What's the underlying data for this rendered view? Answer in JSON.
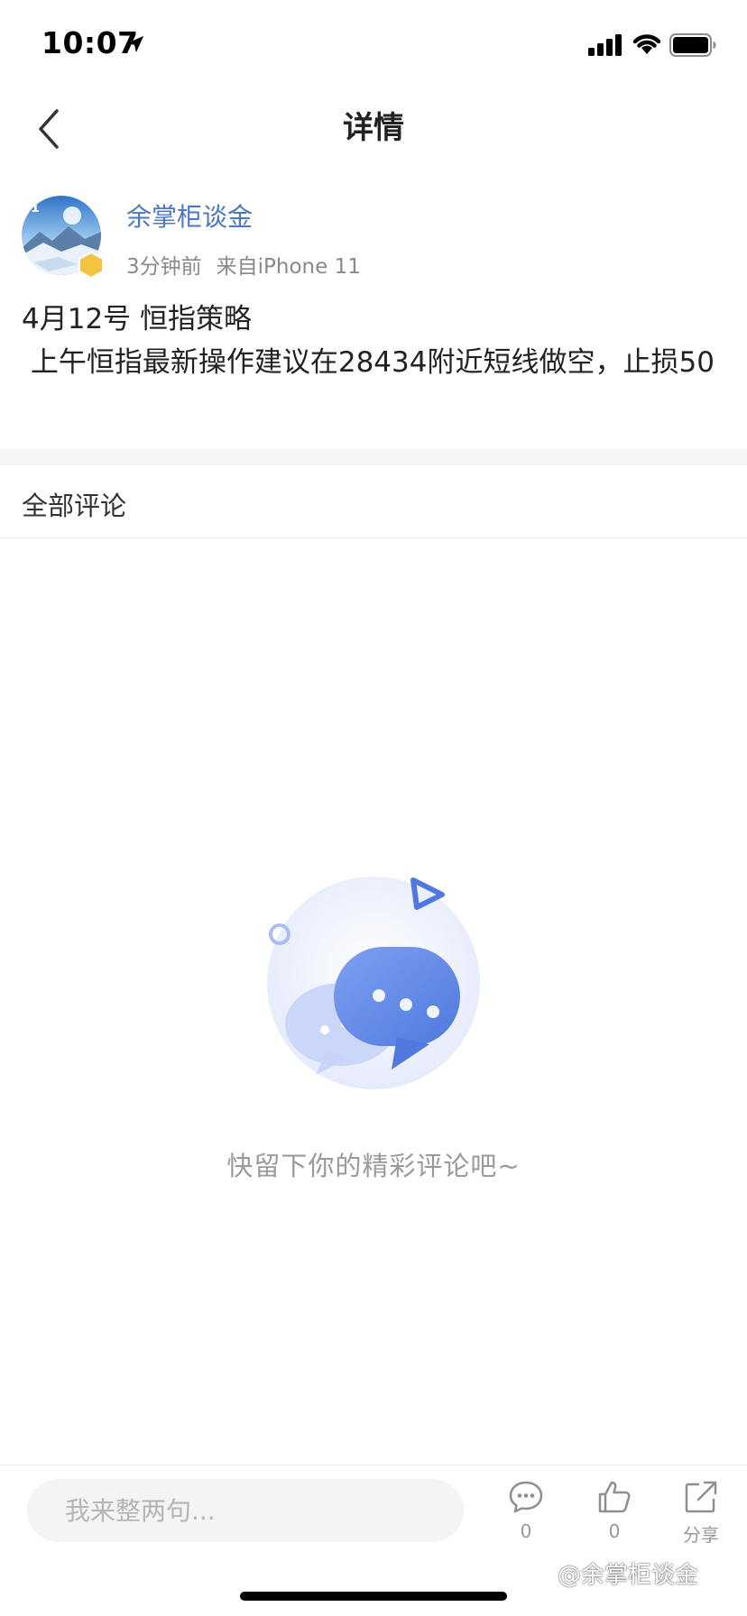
{
  "status_bar": {
    "time": "10:07",
    "icons": [
      "location-arrow-icon",
      "cellular-signal-icon",
      "wifi-icon",
      "battery-icon"
    ]
  },
  "nav": {
    "title": "详情",
    "back_icon": "chevron-left-icon"
  },
  "post": {
    "author": "余掌柜谈金",
    "level": "1",
    "time_ago": "3分钟前",
    "source": "来自iPhone 11",
    "content": "4月12号 恒指策略\n 上午恒指最新操作建议在28434附近短线做空，止损50"
  },
  "comments": {
    "header": "全部评论",
    "empty_text": "快留下你的精彩评论吧~",
    "empty_icon": "chat-bubbles-illustration"
  },
  "bottom_bar": {
    "input_placeholder": "我来整两句...",
    "comment_count": "0",
    "like_count": "0",
    "share_label": "分享"
  },
  "watermark": "@余掌柜谈金",
  "colors": {
    "accent": "#4a78c2",
    "illustration_blue": "#5b86e5",
    "badge_gold": "#f5c342",
    "muted_text": "#9a9a9a"
  }
}
